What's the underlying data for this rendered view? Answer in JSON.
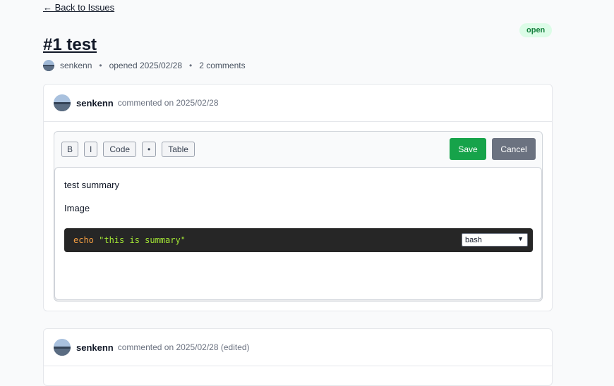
{
  "nav": {
    "back_label": "← Back to Issues"
  },
  "issue": {
    "title": "#1 test",
    "status": "open",
    "author": "senkenn",
    "opened": "opened 2025/02/28",
    "comments_count": "2 comments",
    "separator": "•"
  },
  "comments": [
    {
      "author": "senkenn",
      "meta": "commented on 2025/02/28",
      "editor": {
        "toolbar": [
          "B",
          "I",
          "Code",
          "•",
          "Table"
        ],
        "save_label": "Save",
        "cancel_label": "Cancel",
        "paragraphs": [
          "test summary",
          "Image"
        ],
        "code": {
          "keyword": "echo",
          "string": "\"this is summary\"",
          "language": "bash"
        }
      }
    },
    {
      "author": "senkenn",
      "meta": "commented on 2025/02/28 (edited)"
    }
  ],
  "colors": {
    "save": "#16a34a",
    "cancel": "#6b7280",
    "badge_bg": "#dcfce7",
    "badge_text": "#15803d",
    "code_bg": "#262626"
  },
  "icons": {
    "avatar": "avatar-photo",
    "select_chevron": "chevron-down-icon"
  }
}
